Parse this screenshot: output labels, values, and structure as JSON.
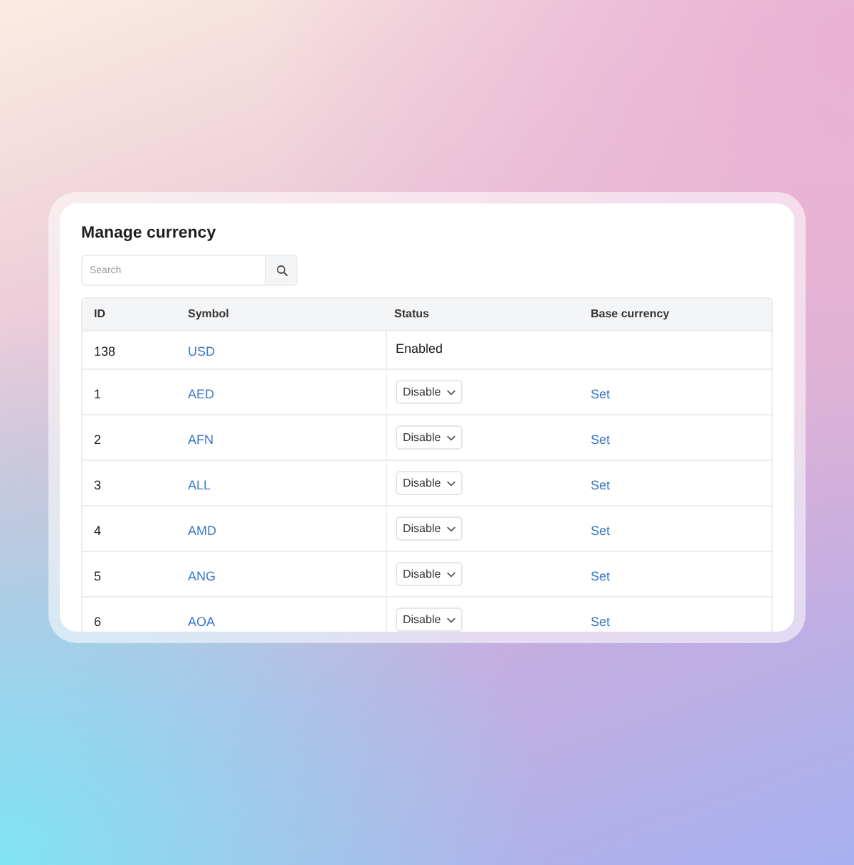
{
  "title": "Manage currency",
  "search": {
    "placeholder": "Search"
  },
  "table": {
    "columns": [
      "ID",
      "Symbol",
      "Status",
      "Base currency"
    ],
    "rows": [
      {
        "id": "138",
        "symbol": "USD",
        "status": {
          "kind": "text",
          "value": "Enabled"
        }
      },
      {
        "id": "1",
        "symbol": "AED",
        "status": {
          "kind": "select",
          "value": "Disable"
        },
        "base_currency": "Set"
      },
      {
        "id": "2",
        "symbol": "AFN",
        "status": {
          "kind": "select",
          "value": "Disable"
        },
        "base_currency": "Set"
      },
      {
        "id": "3",
        "symbol": "ALL",
        "status": {
          "kind": "select",
          "value": "Disable"
        },
        "base_currency": "Set"
      },
      {
        "id": "4",
        "symbol": "AMD",
        "status": {
          "kind": "select",
          "value": "Disable"
        },
        "base_currency": "Set"
      },
      {
        "id": "5",
        "symbol": "ANG",
        "status": {
          "kind": "select",
          "value": "Disable"
        },
        "base_currency": "Set"
      },
      {
        "id": "6",
        "symbol": "AOA",
        "status": {
          "kind": "select",
          "value": "Disable"
        },
        "base_currency": "Set"
      }
    ]
  }
}
